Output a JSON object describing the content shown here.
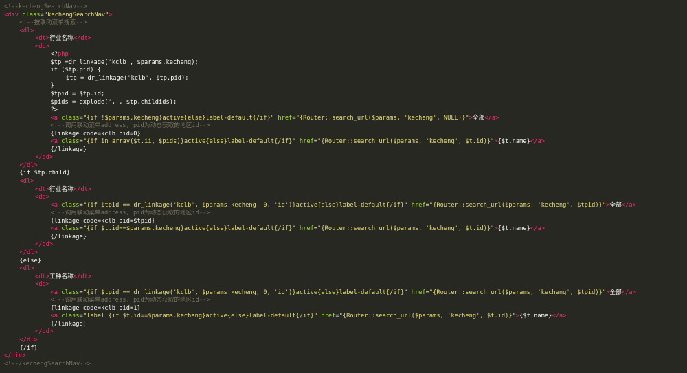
{
  "editor": {
    "theme": {
      "background": "#272822",
      "comment": "#75715e",
      "tag": "#f92672",
      "attribute": "#a6e22e",
      "string": "#e6db74",
      "text": "#f8f8f2"
    },
    "lines": [
      {
        "indent": 0,
        "tokens": [
          {
            "t": "com",
            "v": "<!--kechengSearchNav-->"
          }
        ]
      },
      {
        "indent": 0,
        "tokens": [
          {
            "t": "tag",
            "v": "<div"
          },
          {
            "t": "txt",
            "v": " "
          },
          {
            "t": "attr",
            "v": "class"
          },
          {
            "t": "txt",
            "v": "="
          },
          {
            "t": "str",
            "v": "\"kechengSearchNav\""
          },
          {
            "t": "tag",
            "v": ">"
          }
        ]
      },
      {
        "indent": 1,
        "tokens": [
          {
            "t": "com",
            "v": "<!--按联动菜单搜索-->"
          }
        ]
      },
      {
        "indent": 1,
        "tokens": [
          {
            "t": "tag",
            "v": "<dl>"
          }
        ]
      },
      {
        "indent": 2,
        "tokens": [
          {
            "t": "tag",
            "v": "<dt>"
          },
          {
            "t": "txt",
            "v": "行业名称"
          },
          {
            "t": "tag",
            "v": "</dt>"
          }
        ]
      },
      {
        "indent": 2,
        "tokens": [
          {
            "t": "tag",
            "v": "<dd>"
          }
        ]
      },
      {
        "indent": 3,
        "tokens": [
          {
            "t": "txt",
            "v": "<?"
          },
          {
            "t": "php",
            "v": "php"
          }
        ]
      },
      {
        "indent": 3,
        "tokens": [
          {
            "t": "txt",
            "v": "$tp =dr_linkage('kclb', $params.kecheng);"
          }
        ]
      },
      {
        "indent": 3,
        "tokens": [
          {
            "t": "txt",
            "v": "if ($tp.pid) {"
          }
        ]
      },
      {
        "indent": 4,
        "tokens": [
          {
            "t": "txt",
            "v": "$tp = dr_linkage('kclb', $tp.pid);"
          }
        ]
      },
      {
        "indent": 3,
        "tokens": [
          {
            "t": "txt",
            "v": "}"
          }
        ]
      },
      {
        "indent": 3,
        "tokens": [
          {
            "t": "txt",
            "v": "$tpid = $tp.id;"
          }
        ]
      },
      {
        "indent": 3,
        "tokens": [
          {
            "t": "txt",
            "v": "$pids = explode(',', $tp.childids);"
          }
        ]
      },
      {
        "indent": 3,
        "tokens": [
          {
            "t": "txt",
            "v": "?>"
          }
        ]
      },
      {
        "indent": 3,
        "tokens": [
          {
            "t": "tag",
            "v": "<a"
          },
          {
            "t": "txt",
            "v": " "
          },
          {
            "t": "attr",
            "v": "class"
          },
          {
            "t": "txt",
            "v": "="
          },
          {
            "t": "str",
            "v": "\"{if !$params.kecheng}active{else}label-default{/if}\""
          },
          {
            "t": "txt",
            "v": " "
          },
          {
            "t": "attr",
            "v": "href"
          },
          {
            "t": "txt",
            "v": "="
          },
          {
            "t": "str",
            "v": "\"{Router::search_url($params, 'kecheng', NULL)}\""
          },
          {
            "t": "tag",
            "v": ">"
          },
          {
            "t": "txt",
            "v": "全部"
          },
          {
            "t": "tag",
            "v": "</a>"
          }
        ]
      },
      {
        "indent": 3,
        "tokens": [
          {
            "t": "com",
            "v": "<!--调用联动菜单address, pid为动态获取的地区id-->"
          }
        ]
      },
      {
        "indent": 3,
        "tokens": [
          {
            "t": "txt",
            "v": "{linkage code=kclb pid=0}"
          }
        ]
      },
      {
        "indent": 3,
        "tokens": [
          {
            "t": "tag",
            "v": "<a"
          },
          {
            "t": "txt",
            "v": " "
          },
          {
            "t": "attr",
            "v": "class"
          },
          {
            "t": "txt",
            "v": "="
          },
          {
            "t": "str",
            "v": "\"{if in_array($t.ii, $pids)}active{else}label-default{/if}\""
          },
          {
            "t": "txt",
            "v": " "
          },
          {
            "t": "attr",
            "v": "href"
          },
          {
            "t": "txt",
            "v": "="
          },
          {
            "t": "str",
            "v": "\"{Router::search_url($params, 'kecheng', $t.id)}\""
          },
          {
            "t": "tag",
            "v": ">"
          },
          {
            "t": "txt",
            "v": "{$t.name}"
          },
          {
            "t": "tag",
            "v": "</a>"
          }
        ]
      },
      {
        "indent": 3,
        "tokens": [
          {
            "t": "txt",
            "v": "{/linkage}"
          }
        ]
      },
      {
        "indent": 2,
        "tokens": [
          {
            "t": "tag",
            "v": "</dd>"
          }
        ]
      },
      {
        "indent": 1,
        "tokens": [
          {
            "t": "tag",
            "v": "</dl>"
          }
        ]
      },
      {
        "indent": 1,
        "tokens": [
          {
            "t": "txt",
            "v": "{if $tp.child}"
          }
        ]
      },
      {
        "indent": 1,
        "tokens": [
          {
            "t": "tag",
            "v": "<dl>"
          }
        ]
      },
      {
        "indent": 2,
        "tokens": [
          {
            "t": "tag",
            "v": "<dt>"
          },
          {
            "t": "txt",
            "v": "行业名称"
          },
          {
            "t": "tag",
            "v": "</dt>"
          }
        ]
      },
      {
        "indent": 2,
        "tokens": [
          {
            "t": "tag",
            "v": "<dd>"
          }
        ]
      },
      {
        "indent": 3,
        "tokens": [
          {
            "t": "tag",
            "v": "<a"
          },
          {
            "t": "txt",
            "v": " "
          },
          {
            "t": "attr",
            "v": "class"
          },
          {
            "t": "txt",
            "v": "="
          },
          {
            "t": "str",
            "v": "\"{if $tpid == dr_linkage('kclb', $params.kecheng, 0, 'id')}active{else}label-default{/if}\""
          },
          {
            "t": "txt",
            "v": " "
          },
          {
            "t": "attr",
            "v": "href"
          },
          {
            "t": "txt",
            "v": "="
          },
          {
            "t": "str",
            "v": "\"{Router::search_url($params, 'kecheng', $tpid)}\""
          },
          {
            "t": "tag",
            "v": ">"
          },
          {
            "t": "txt",
            "v": "全部"
          },
          {
            "t": "tag",
            "v": "</a>"
          }
        ]
      },
      {
        "indent": 3,
        "tokens": [
          {
            "t": "com",
            "v": "<!--调用联动菜单address, pid为动态获取的地区id-->"
          }
        ]
      },
      {
        "indent": 3,
        "tokens": [
          {
            "t": "txt",
            "v": "{linkage code=kclb pid=$tpid}"
          }
        ]
      },
      {
        "indent": 3,
        "tokens": [
          {
            "t": "tag",
            "v": "<a"
          },
          {
            "t": "txt",
            "v": " "
          },
          {
            "t": "attr",
            "v": "class"
          },
          {
            "t": "txt",
            "v": "="
          },
          {
            "t": "str",
            "v": "\"{if $t.id==$params.kecheng}active{else}label-default{/if}\""
          },
          {
            "t": "txt",
            "v": " "
          },
          {
            "t": "attr",
            "v": "href"
          },
          {
            "t": "txt",
            "v": "="
          },
          {
            "t": "str",
            "v": "\"{Router::search_url($params, 'kecheng', $t.id)}\""
          },
          {
            "t": "tag",
            "v": ">"
          },
          {
            "t": "txt",
            "v": "{$t.name}"
          },
          {
            "t": "tag",
            "v": "</a>"
          }
        ]
      },
      {
        "indent": 3,
        "tokens": [
          {
            "t": "txt",
            "v": "{/linkage}"
          }
        ]
      },
      {
        "indent": 2,
        "tokens": [
          {
            "t": "tag",
            "v": "</dd>"
          }
        ]
      },
      {
        "indent": 1,
        "tokens": [
          {
            "t": "tag",
            "v": "</dl>"
          }
        ]
      },
      {
        "indent": 1,
        "tokens": [
          {
            "t": "txt",
            "v": "{else}"
          }
        ]
      },
      {
        "indent": 1,
        "tokens": [
          {
            "t": "tag",
            "v": "<dl>"
          }
        ]
      },
      {
        "indent": 2,
        "tokens": [
          {
            "t": "tag",
            "v": "<dt>"
          },
          {
            "t": "txt",
            "v": "工种名称"
          },
          {
            "t": "tag",
            "v": "</dt>"
          }
        ]
      },
      {
        "indent": 2,
        "tokens": [
          {
            "t": "tag",
            "v": "<dd>"
          }
        ]
      },
      {
        "indent": 3,
        "tokens": [
          {
            "t": "tag",
            "v": "<a"
          },
          {
            "t": "txt",
            "v": " "
          },
          {
            "t": "attr",
            "v": "class"
          },
          {
            "t": "txt",
            "v": "="
          },
          {
            "t": "str",
            "v": "\"{if $tpid == dr_linkage('kclb', $params.kecheng, 0, 'id')}active{else}label-default{/if}\""
          },
          {
            "t": "txt",
            "v": " "
          },
          {
            "t": "attr",
            "v": "href"
          },
          {
            "t": "txt",
            "v": "="
          },
          {
            "t": "str",
            "v": "\"{Router::search_url($params, 'kecheng', $tpid)}\""
          },
          {
            "t": "tag",
            "v": ">"
          },
          {
            "t": "txt",
            "v": "全部"
          },
          {
            "t": "tag",
            "v": "</a>"
          }
        ]
      },
      {
        "indent": 3,
        "tokens": [
          {
            "t": "com",
            "v": "<!--调用联动菜单address, pid为动态获取的地区id-->"
          }
        ]
      },
      {
        "indent": 3,
        "tokens": [
          {
            "t": "txt",
            "v": "{linkage code=kclb pid=1}"
          }
        ]
      },
      {
        "indent": 3,
        "tokens": [
          {
            "t": "tag",
            "v": "<a"
          },
          {
            "t": "txt",
            "v": " "
          },
          {
            "t": "attr",
            "v": "class"
          },
          {
            "t": "txt",
            "v": "="
          },
          {
            "t": "str",
            "v": "\"label {if $t.id==$params.kecheng}active{else}label-default{/if}\""
          },
          {
            "t": "txt",
            "v": " "
          },
          {
            "t": "attr",
            "v": "href"
          },
          {
            "t": "txt",
            "v": "="
          },
          {
            "t": "str",
            "v": "\"{Router::search_url($params, 'kecheng', $t.id)}\""
          },
          {
            "t": "tag",
            "v": ">"
          },
          {
            "t": "txt",
            "v": "{$t.name}"
          },
          {
            "t": "tag",
            "v": "</a>"
          }
        ]
      },
      {
        "indent": 3,
        "tokens": [
          {
            "t": "txt",
            "v": "{/linkage}"
          }
        ]
      },
      {
        "indent": 2,
        "tokens": [
          {
            "t": "tag",
            "v": "</dd>"
          }
        ]
      },
      {
        "indent": 1,
        "tokens": [
          {
            "t": "tag",
            "v": "</dl>"
          }
        ]
      },
      {
        "indent": 1,
        "tokens": [
          {
            "t": "txt",
            "v": "{/if}"
          }
        ]
      },
      {
        "indent": 0,
        "tokens": [
          {
            "t": "tag",
            "v": "</div>"
          }
        ]
      },
      {
        "indent": 0,
        "tokens": [
          {
            "t": "com",
            "v": "<!--/kechengSearchNav-->"
          }
        ]
      }
    ]
  }
}
